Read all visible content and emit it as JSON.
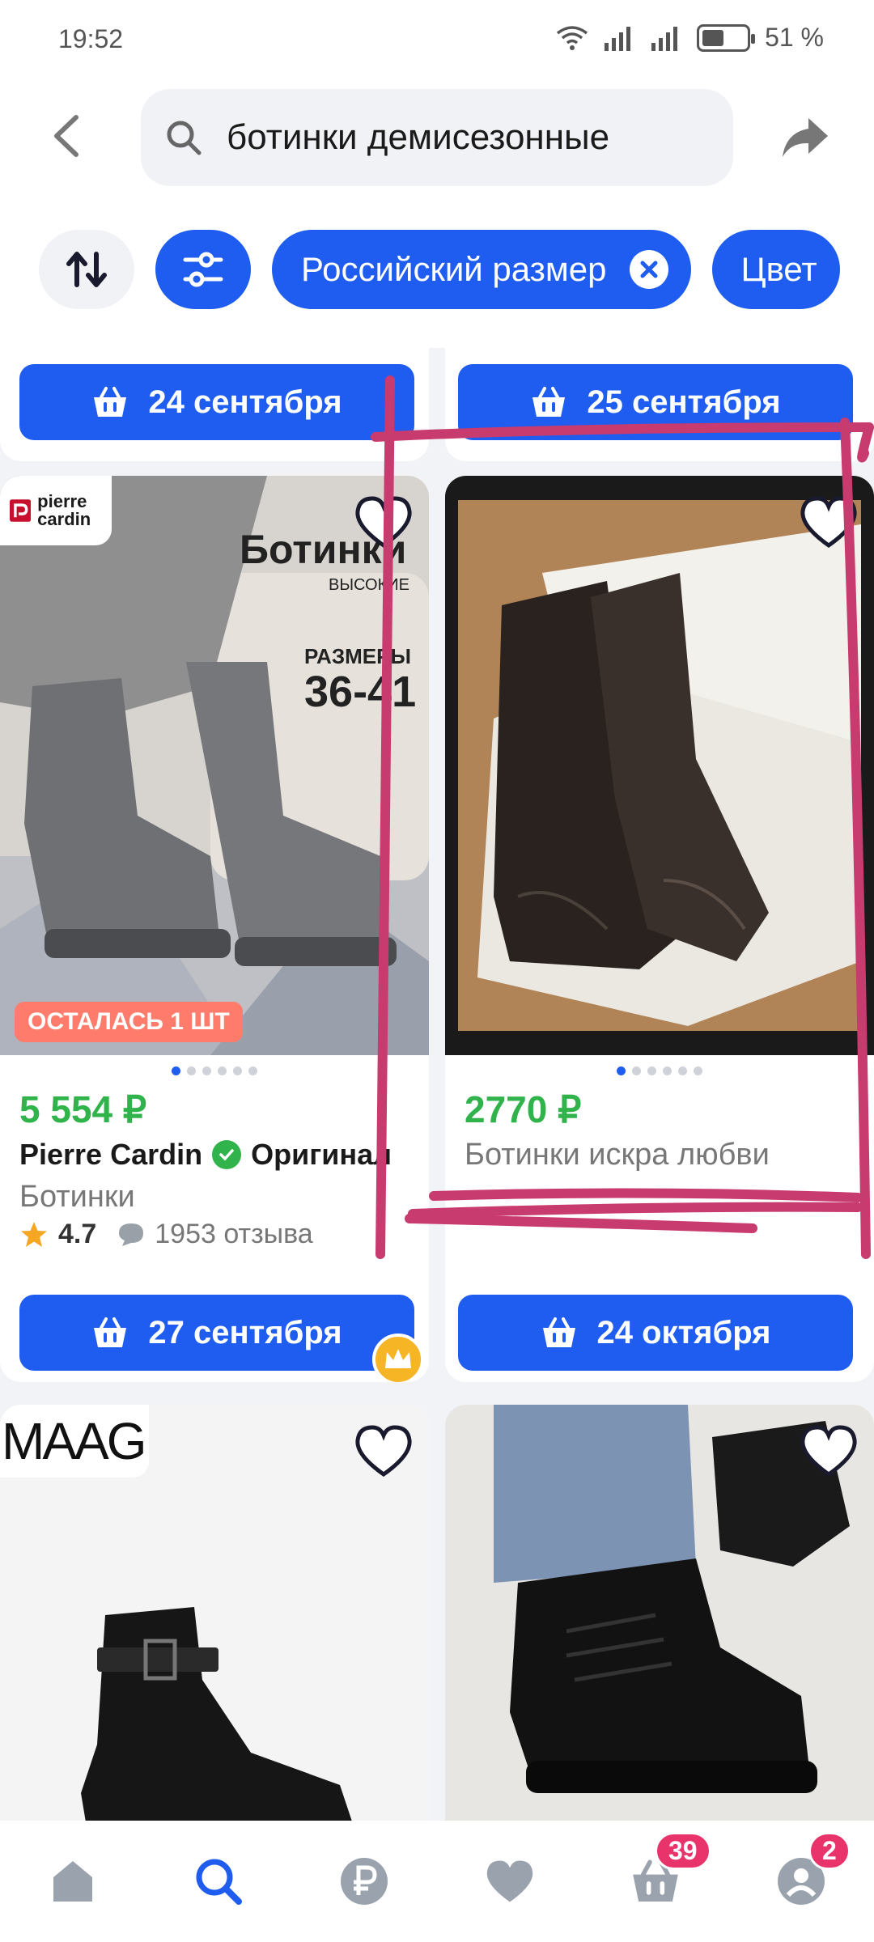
{
  "status": {
    "time": "19:52",
    "battery": "51 %"
  },
  "search": {
    "value": "ботинки демисезонные"
  },
  "filters": {
    "chip_label": "Российский размер",
    "chip_color": "Цвет"
  },
  "colors": {
    "accent": "#1f5df0",
    "price": "#2fb34a",
    "badge": "#e8336b",
    "annotation": "#c83b6e"
  },
  "row0": {
    "left_date": "24 сентября",
    "right_date": "25 сентября"
  },
  "products": [
    {
      "brand_logo": "pierre cardin",
      "overlay_title": "Ботинки",
      "overlay_sub": "ВЫСОКИЕ",
      "overlay_sizes_label": "РАЗМЕРЫ",
      "overlay_sizes": "36-41",
      "stock_badge": "ОСТАЛАСЬ 1 ШТ",
      "price": "5 554 ₽",
      "brand": "Pierre Cardin",
      "original_label": "Оригинал",
      "name": "Ботинки",
      "rating": "4.7",
      "reviews": "1953 отзыва",
      "delivery": "27 сентября"
    },
    {
      "price": "2770 ₽",
      "name": "Ботинки искра любви",
      "delivery": "24 октября"
    }
  ],
  "row2": {
    "left_logo": "MAAG"
  },
  "nav": {
    "cart_count": "39",
    "profile_count": "2"
  }
}
